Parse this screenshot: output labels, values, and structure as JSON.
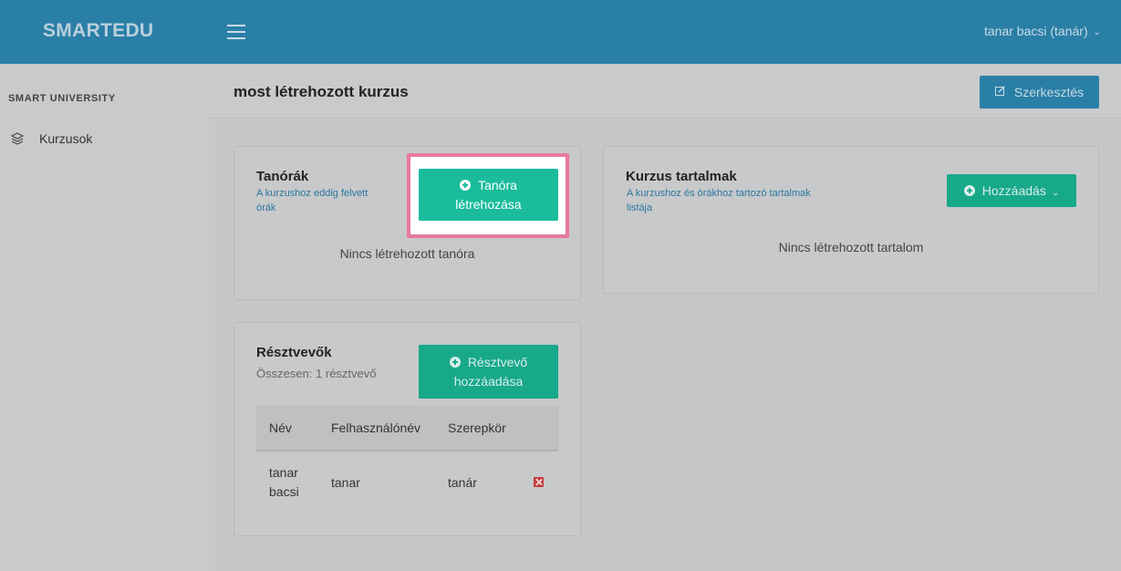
{
  "header": {
    "brand": "SMARTEDU",
    "user": "tanar bacsi (tanár)"
  },
  "sidebar": {
    "heading": "SMART UNIVERSITY",
    "items": [
      {
        "label": "Kurzusok",
        "icon": "layers-icon"
      }
    ]
  },
  "page": {
    "title": "most létrehozott kurzus",
    "edit_label": "Szerkesztés"
  },
  "lessons": {
    "title": "Tanórák",
    "subtitle_line1": "A kurzushoz eddig felvett",
    "subtitle_line2": "órák",
    "button_line1": "Tanóra",
    "button_line2": "létrehozása",
    "empty": "Nincs létrehozott tanóra"
  },
  "contents": {
    "title": "Kurzus tartalmak",
    "subtitle_line1": "A kurzushoz és órákhoz tartozó tartalmak",
    "subtitle_line2": "listája",
    "button": "Hozzáadás",
    "empty": "Nincs létrehozott tartalom"
  },
  "participants": {
    "title": "Résztvevők",
    "subtitle": "Összesen: 1 résztvevő",
    "button_line1": "Résztvevő",
    "button_line2": "hozzáadása",
    "columns": [
      "Név",
      "Felhasználónév",
      "Szerepkör"
    ],
    "rows": [
      {
        "name_line1": "tanar",
        "name_line2": "bacsi",
        "username": "tanar",
        "role": "tanár"
      }
    ]
  },
  "colors": {
    "header": "#2a7fa6",
    "accent_green": "#1abc9c",
    "highlight": "#e8799c",
    "danger": "#c43b3b"
  }
}
